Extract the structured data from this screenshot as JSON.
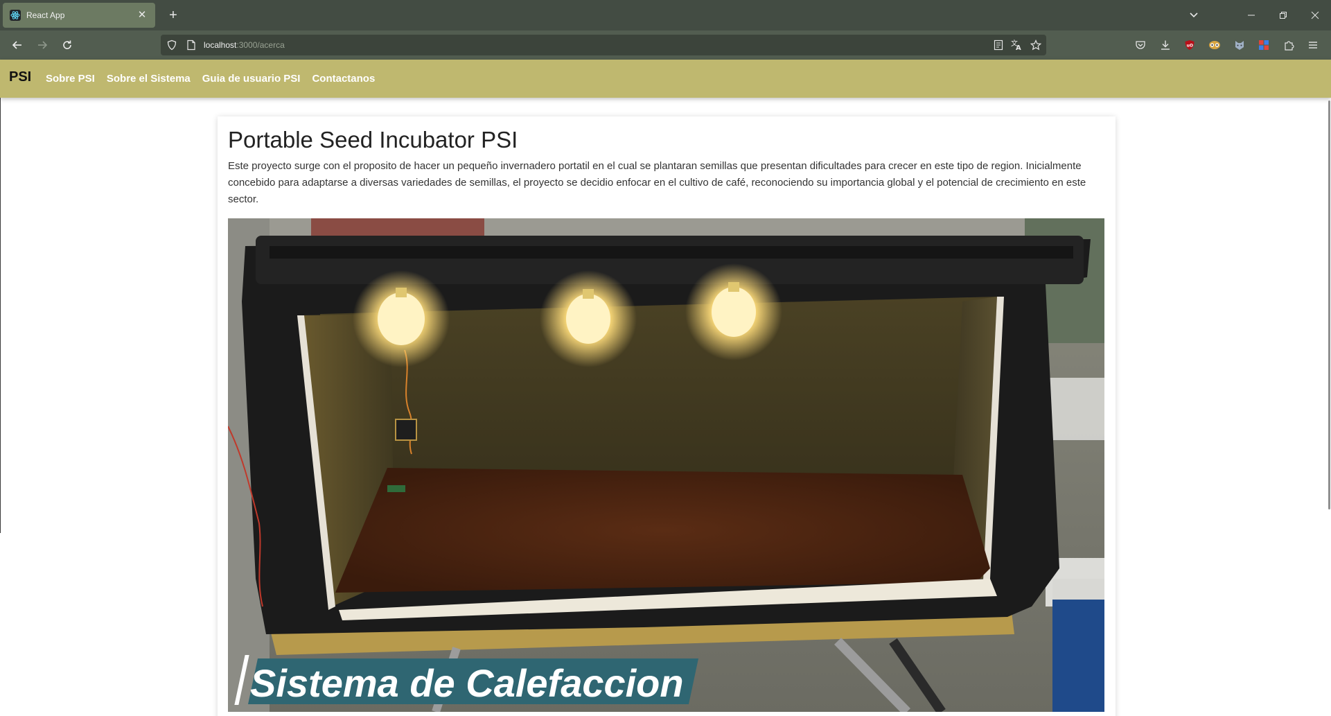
{
  "browser": {
    "tab_title": "React App",
    "tab_close_glyph": "✕",
    "new_tab_glyph": "+",
    "url_host": "localhost",
    "url_path": ":3000/acerca"
  },
  "app": {
    "brand": "PSI",
    "nav": [
      {
        "label": "Sobre PSI"
      },
      {
        "label": "Sobre el Sistema"
      },
      {
        "label": "Guia de usuario PSI"
      },
      {
        "label": "Contactanos"
      }
    ]
  },
  "content": {
    "title": "Portable Seed Incubator PSI",
    "paragraph": "Este proyecto surge con el proposito de hacer un pequeño invernadero portatil en el cual se plantaran semillas que presentan dificultades para crecer en este tipo de region. Inicialmente concebido para adaptarse a diversas variedades de semillas, el proyecto se decidio enfocar en el cultivo de café, reconociendo su importancia global y el potencial de crecimiento en este sector.",
    "media_caption": "Sistema de Calefaccion"
  },
  "theme": {
    "navbar_color": "#bfb86f",
    "browser_frame": "#434c43",
    "caption_color": "#2f6672"
  }
}
